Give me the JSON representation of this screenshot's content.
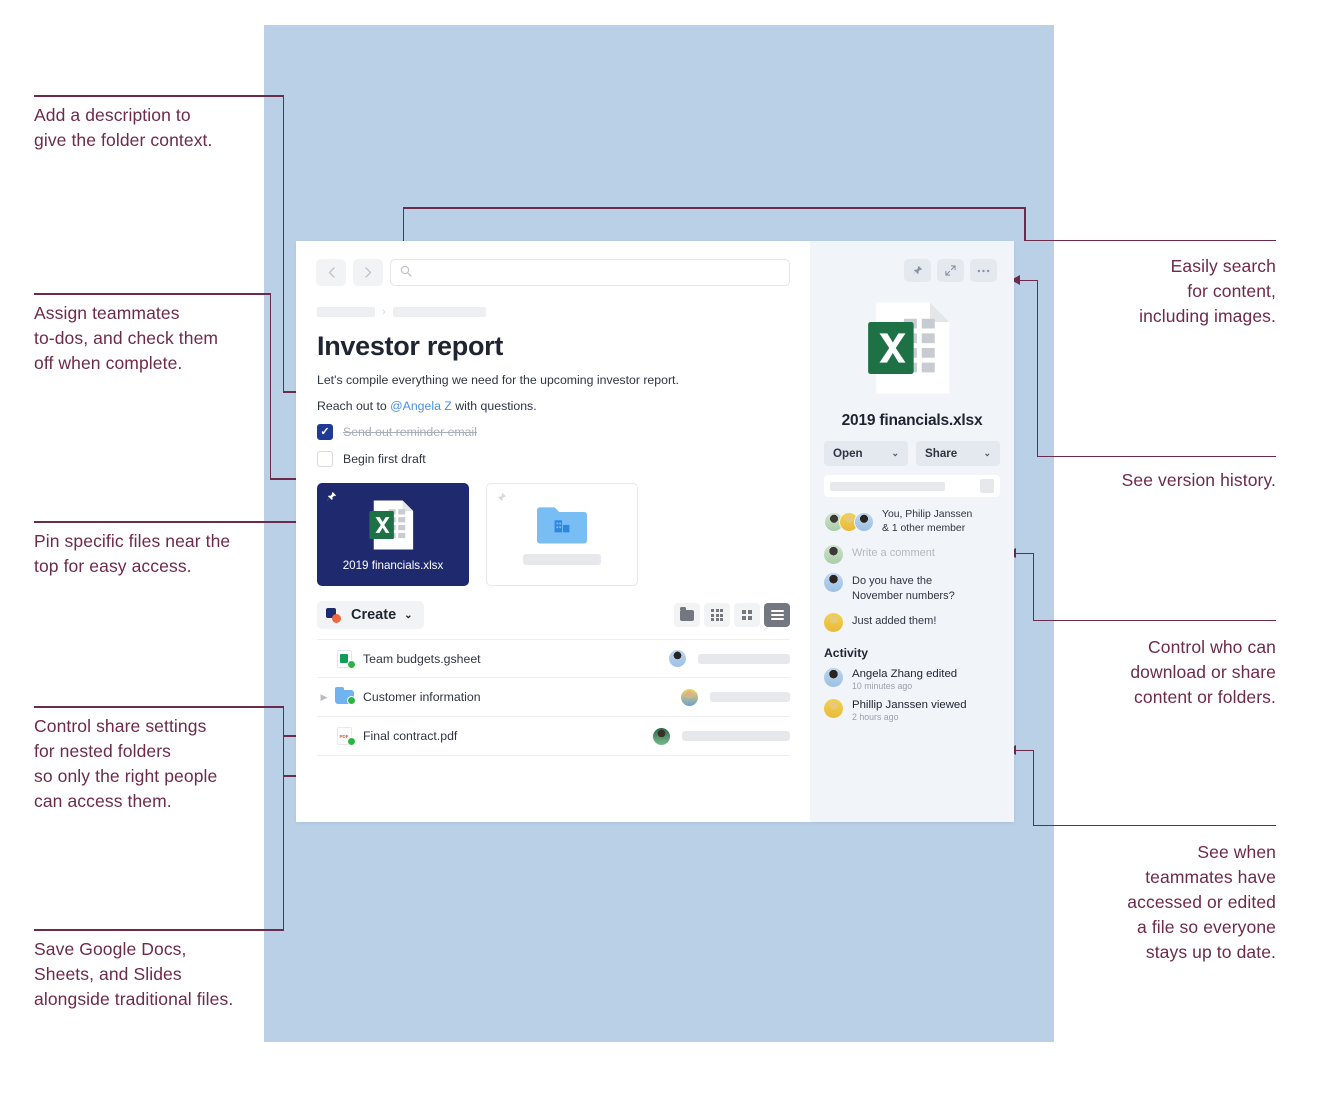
{
  "colors": {
    "backdrop": "#b9d0e6",
    "annotation": "#6e2a4a",
    "pinned_card": "#1f2a6e",
    "mention_link": "#4a90e2",
    "checkbox_checked": "#1f3a93"
  },
  "callouts": {
    "left": [
      {
        "id": "description",
        "text": "Add a description to\ngive the folder context."
      },
      {
        "id": "todos",
        "text": "Assign teammates\nto-dos, and check them\noff when complete."
      },
      {
        "id": "pin",
        "text": "Pin specific files near the\ntop for easy access."
      },
      {
        "id": "nested-share",
        "text": "Control share settings\nfor nested folders\nso only the right people\ncan access them."
      },
      {
        "id": "google-docs",
        "text": "Save Google Docs,\nSheets, and Slides\nalongside traditional files."
      }
    ],
    "right": [
      {
        "id": "search",
        "text": "Easily search\nfor content,\nincluding images."
      },
      {
        "id": "version-history",
        "text": "See version history."
      },
      {
        "id": "download-share",
        "text": "Control who can\ndownload or share\ncontent or folders."
      },
      {
        "id": "activity",
        "text": "See when\nteammates have\naccessed or edited\na file so everyone\nstays up to date."
      }
    ]
  },
  "app": {
    "topbar": {
      "back_icon": "chevron-left-icon",
      "forward_icon": "chevron-right-icon",
      "search_icon": "search-icon",
      "search_placeholder": ""
    },
    "breadcrumb": {
      "items": [
        "",
        ""
      ],
      "separator": "›"
    },
    "title": "Investor report",
    "description": "Let's compile everything we need for the upcoming investor report.",
    "reach_out": {
      "prefix": "Reach out to ",
      "mention": "@Angela Z",
      "suffix": " with questions."
    },
    "todos": [
      {
        "label": "Send out reminder email",
        "checked": true
      },
      {
        "label": "Begin first draft",
        "checked": false
      }
    ],
    "pinned_cards": [
      {
        "name": "2019 financials.xlsx",
        "pinned": true,
        "icon": "excel-file-icon"
      },
      {
        "name": "",
        "pinned": false,
        "icon": "blue-folder-icon"
      }
    ],
    "toolbar": {
      "create_label": "Create",
      "create_caret": "⌄",
      "views": [
        {
          "id": "folder-view",
          "icon": "folder-icon",
          "active": false
        },
        {
          "id": "grid-large-view",
          "icon": "grid-9-icon",
          "active": false
        },
        {
          "id": "grid-small-view",
          "icon": "grid-4-icon",
          "active": false
        },
        {
          "id": "list-view",
          "icon": "list-icon",
          "active": true
        }
      ]
    },
    "files": [
      {
        "name": "Team budgets.gsheet",
        "type": "gsheet",
        "expandable": false,
        "synced": true,
        "ghost_width": 92
      },
      {
        "name": "Customer information",
        "type": "folder",
        "expandable": true,
        "synced": true,
        "ghost_width": 80
      },
      {
        "name": "Final contract.pdf",
        "type": "pdf",
        "expandable": false,
        "synced": true,
        "ghost_width": 108
      }
    ]
  },
  "side_panel": {
    "actions": [
      {
        "id": "pin-button",
        "icon": "pin-icon"
      },
      {
        "id": "expand-button",
        "icon": "expand-icon"
      },
      {
        "id": "more-button",
        "icon": "ellipsis-icon"
      }
    ],
    "file_name": "2019 financials.xlsx",
    "file_icon": "excel-file-icon",
    "buttons": [
      {
        "label": "Open",
        "caret": "⌄"
      },
      {
        "label": "Share",
        "caret": "⌄"
      }
    ],
    "members_text": "You, Philip Janssen\n& 1 other member",
    "comment_placeholder": "Write a comment",
    "comments": [
      {
        "text": "Do you have the\nNovember numbers?"
      },
      {
        "text": "Just added them!"
      }
    ],
    "activity_heading": "Activity",
    "activity": [
      {
        "title": "Angela Zhang edited",
        "time": "10 minutes ago"
      },
      {
        "title": "Phillip Janssen viewed",
        "time": "2 hours ago"
      }
    ]
  }
}
